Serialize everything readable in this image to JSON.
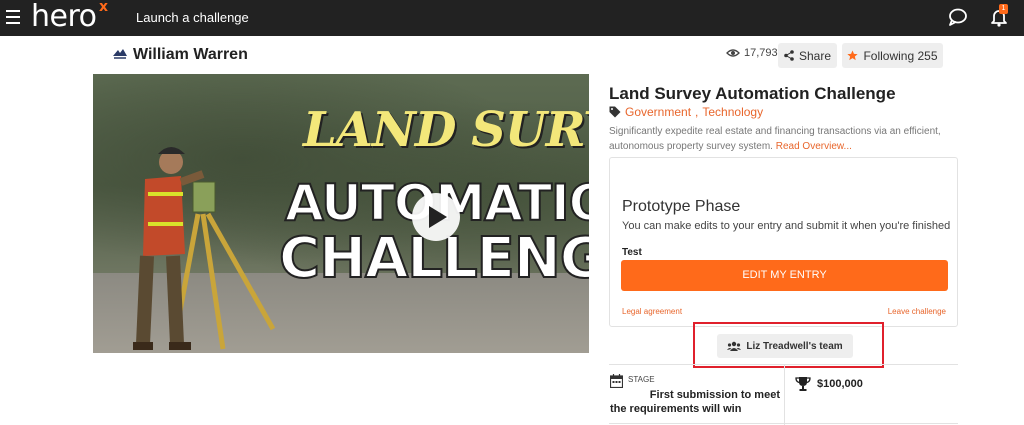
{
  "topbar": {
    "logo_text": "hero",
    "logo_mark": "x",
    "launch_label": "Launch a challenge",
    "notification_count": "1",
    "icons": [
      "menu-icon",
      "chat-icon",
      "bell-icon"
    ]
  },
  "profile": {
    "name": "William Warren",
    "views": "17,793",
    "share_label": "Share",
    "follow_label": "Following 255"
  },
  "video": {
    "title_line1": "LAND SURVEY",
    "title_line2": "AUTOMATION",
    "title_line3": "CHALLENGE"
  },
  "challenge": {
    "title": "Land Survey Automation Challenge",
    "tags": [
      "Government",
      "Technology"
    ],
    "description": "Significantly expedite real estate and financing transactions via an efficient, autonomous property survey system.",
    "read_more": "Read Overview..."
  },
  "phase": {
    "title": "Prototype Phase",
    "subtitle": "You can make edits to your entry and submit it when you're finished",
    "entry_name": "Test",
    "edit_label": "EDIT MY ENTRY",
    "legal_label": "Legal agreement",
    "leave_label": "Leave challenge"
  },
  "team": {
    "label": "Liz Treadwell's team"
  },
  "stats": {
    "stage_label": "STAGE",
    "stage_line1": "First submission to meet",
    "stage_line2": "the requirements will win",
    "prize": "$100,000"
  },
  "colors": {
    "accent": "#ff6a1a",
    "link": "#e8662c",
    "topbar": "#222222",
    "highlight": "#e0202c"
  }
}
